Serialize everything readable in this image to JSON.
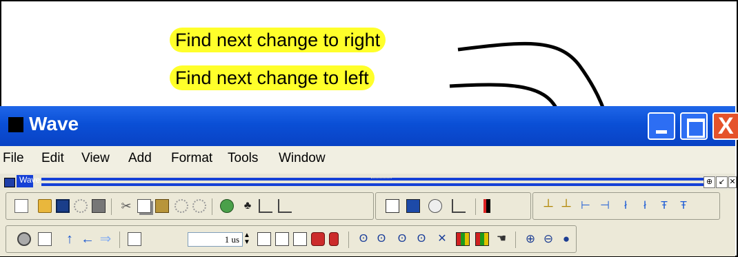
{
  "callouts": {
    "right": "Find next change to right",
    "left": "Find next change to left",
    "color": "#ffff2a"
  },
  "window": {
    "title": "Wave",
    "controls": [
      "minimize-icon",
      "maximize-icon",
      "close-icon"
    ],
    "close_glyph": "X",
    "title_color": "#0a4fd6"
  },
  "menu": {
    "items": [
      "File",
      "Edit",
      "View",
      "Add",
      "Format",
      "Tools",
      "Window"
    ]
  },
  "subwindow": {
    "title": "Wave",
    "buttons": [
      "⊕",
      "↙",
      "✕"
    ]
  },
  "toolbar2": {
    "time_value": "1 us"
  }
}
